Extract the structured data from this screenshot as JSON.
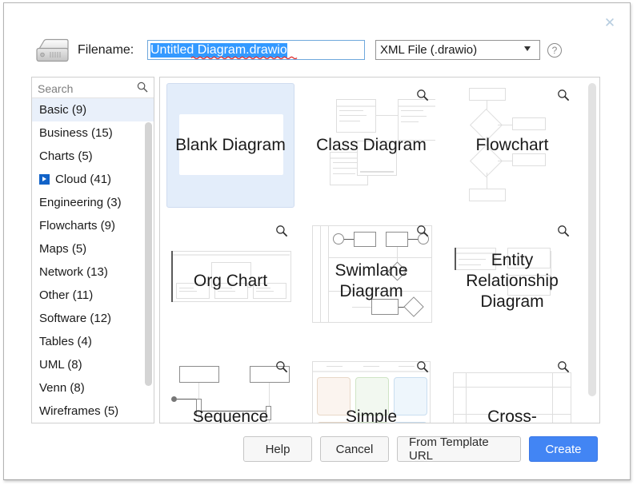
{
  "window": {
    "close_label": "✕"
  },
  "header": {
    "drive_icon": "hard-drive-icon",
    "filename_label": "Filename:",
    "filename_value": "Untitled Diagram.drawio",
    "filename_placeholder": "Untitled Diagram.drawio",
    "filetype_selected": "XML File (.drawio)",
    "filetype_options": [
      "XML File (.drawio)"
    ],
    "help_icon_label": "?"
  },
  "sidebar": {
    "search_placeholder": "Search",
    "search_value": "",
    "search_icon": "search-icon",
    "items": [
      {
        "label": "Basic (9)",
        "selected": true,
        "expandable": false
      },
      {
        "label": "Business (15)",
        "selected": false,
        "expandable": false
      },
      {
        "label": "Charts (5)",
        "selected": false,
        "expandable": false
      },
      {
        "label": "Cloud (41)",
        "selected": false,
        "expandable": true
      },
      {
        "label": "Engineering (3)",
        "selected": false,
        "expandable": false
      },
      {
        "label": "Flowcharts (9)",
        "selected": false,
        "expandable": false
      },
      {
        "label": "Maps (5)",
        "selected": false,
        "expandable": false
      },
      {
        "label": "Network (13)",
        "selected": false,
        "expandable": false
      },
      {
        "label": "Other (11)",
        "selected": false,
        "expandable": false
      },
      {
        "label": "Software (12)",
        "selected": false,
        "expandable": false
      },
      {
        "label": "Tables (4)",
        "selected": false,
        "expandable": false
      },
      {
        "label": "UML (8)",
        "selected": false,
        "expandable": false
      },
      {
        "label": "Venn (8)",
        "selected": false,
        "expandable": false
      },
      {
        "label": "Wireframes (5)",
        "selected": false,
        "expandable": false
      }
    ]
  },
  "templates": [
    {
      "title": "Blank Diagram",
      "selected": true,
      "zoom": false
    },
    {
      "title": "Class Diagram",
      "selected": false,
      "zoom": true
    },
    {
      "title": "Flowchart",
      "selected": false,
      "zoom": true
    },
    {
      "title": "Org Chart",
      "selected": false,
      "zoom": true
    },
    {
      "title": "Swimlane Diagram",
      "selected": false,
      "zoom": true
    },
    {
      "title": "Entity Relationship Diagram",
      "selected": false,
      "zoom": true
    },
    {
      "title": "Sequence",
      "selected": false,
      "zoom": true
    },
    {
      "title": "Simple",
      "selected": false,
      "zoom": true
    },
    {
      "title": "Cross-",
      "selected": false,
      "zoom": true
    }
  ],
  "footer": {
    "help": "Help",
    "cancel": "Cancel",
    "from_template_url": "From Template URL",
    "create": "Create"
  },
  "colors": {
    "accent": "#4285f4",
    "selection": "#3399ff",
    "selected_tile": "#e3edfa",
    "selected_list_item": "#e9f0fa",
    "expand_icon": "#1263c8",
    "close_icon": "#b8cee0",
    "input_border_focus": "#6fa8dc",
    "spellcheck_underline": "#e03030"
  }
}
